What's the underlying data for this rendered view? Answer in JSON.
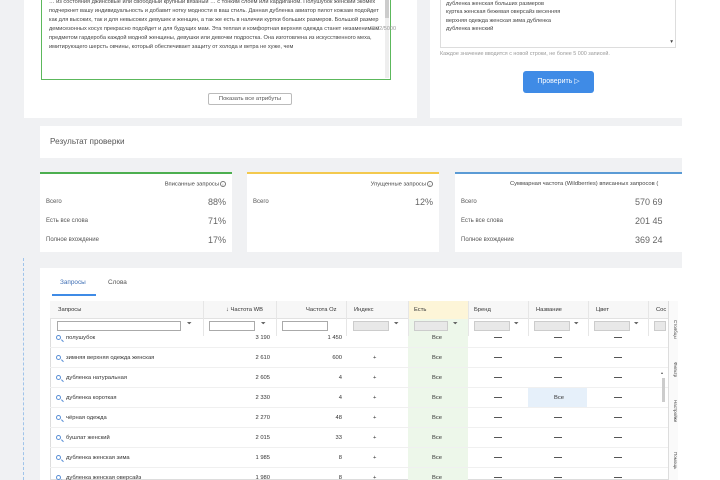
{
  "description": {
    "text": "… из состояния джинсовые или свободный крупный вязаный … с тонким слоем или кардиганом. Полушубок женский экомех подчеркнет вашу индивидуальность и добавит нотку модности в ваш стиль. Данная дубленка авиатор пилот кожзам подойдет как для высоких, так и для невысоких девушек и женщин, а так же есть в наличии куртки больших размеров. Большой размер демисезонных косух прекрасно подойдет и для будущих мам. Эта теплая и комфортная верхняя одежда станет незаменимым предметом гардероба каждой модной женщины, девушки или девочки подростка. Она изготовлена из искусственного меха, имитирующего шерсть овчины, который обеспечивает защиту от холода и ветра не хуже, чем",
    "char_count": "2572/5000",
    "show_attributes_label": "Показать все атрибуты"
  },
  "queries_input": {
    "lines": [
      "дубленка женская больших размеров",
      "куртка женская бежевая оверсайз весенняя",
      "верхняя одежда женская зима дубленка",
      "дубленка женский"
    ],
    "hint": "Каждое значение вводится с новой строки, не более 5 000 записей.",
    "check_button": "Проверить ▷"
  },
  "result": {
    "title": "Результат проверки"
  },
  "stats": [
    {
      "title": "Вписанные запросы",
      "rows": [
        {
          "label": "Всего",
          "value": "88%"
        },
        {
          "label": "Есть все слова",
          "value": "71%"
        },
        {
          "label": "Полное вхождение",
          "value": "17%"
        }
      ]
    },
    {
      "title": "Упущенные запросы",
      "rows": [
        {
          "label": "Всего",
          "value": "12%"
        }
      ]
    },
    {
      "title": "Суммарная частота (Wildberries) вписанных запросов (",
      "rows": [
        {
          "label": "Всего",
          "value": "570 69"
        },
        {
          "label": "Есть все слова",
          "value": "201 45"
        },
        {
          "label": "Полное вхождение",
          "value": "369 24"
        }
      ]
    }
  ],
  "tabs": [
    "Запросы",
    "Слова"
  ],
  "columns": [
    "Запросы",
    "↓ Частота WB",
    "Частота Oz",
    "Индекс",
    "Есть",
    "Бренд",
    "Название",
    "Цвет",
    "Сос"
  ],
  "rows": [
    {
      "query": "полушубок",
      "wb": "3 190",
      "oz": "1 450",
      "index": "",
      "est": "Все",
      "brand": "—",
      "name": "—",
      "color": "—"
    },
    {
      "query": "зимняя верхняя одежда женская",
      "wb": "2 610",
      "oz": "600",
      "index": "+",
      "est": "Все",
      "brand": "—",
      "name": "—",
      "color": "—"
    },
    {
      "query": "дубленка натуральная",
      "wb": "2 605",
      "oz": "4",
      "index": "+",
      "est": "Все",
      "brand": "—",
      "name": "—",
      "color": "—"
    },
    {
      "query": "дубленка короткая",
      "wb": "2 330",
      "oz": "4",
      "index": "+",
      "est": "Все",
      "brand": "—",
      "name": "Все",
      "color": "—"
    },
    {
      "query": "чёрная одежда",
      "wb": "2 270",
      "oz": "48",
      "index": "+",
      "est": "Все",
      "brand": "—",
      "name": "—",
      "color": "—"
    },
    {
      "query": "бушлат женский",
      "wb": "2 015",
      "oz": "33",
      "index": "+",
      "est": "Все",
      "brand": "—",
      "name": "—",
      "color": "—"
    },
    {
      "query": "дубленка женская зима",
      "wb": "1 985",
      "oz": "8",
      "index": "+",
      "est": "Все",
      "brand": "—",
      "name": "—",
      "color": "—"
    },
    {
      "query": "дубленка женская оверсайз",
      "wb": "1 980",
      "oz": "8",
      "index": "+",
      "est": "Все",
      "brand": "—",
      "name": "—",
      "color": "—"
    }
  ],
  "side_tabs": [
    "Столбцы",
    "Фильтр",
    "Настройки",
    "Помощь"
  ],
  "colors": {
    "accent": "#3f8be6",
    "green": "#4caf50",
    "yellow": "#f3c94e",
    "blue": "#5b9bd5"
  }
}
